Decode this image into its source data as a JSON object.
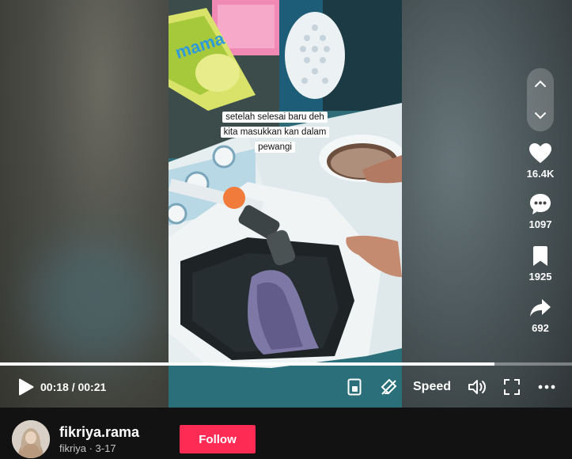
{
  "video": {
    "caption_lines": [
      "setelah selesai baru deh",
      "kita masukkan kan dalam",
      "pewangi"
    ],
    "product_brand": "mama"
  },
  "actions": [
    {
      "name": "like",
      "icon": "heart-icon",
      "count": "16.4K"
    },
    {
      "name": "comment",
      "icon": "comment-icon",
      "count": "1097"
    },
    {
      "name": "save",
      "icon": "bookmark-icon",
      "count": "1925"
    },
    {
      "name": "share",
      "icon": "share-icon",
      "count": "692"
    }
  ],
  "player": {
    "time": "00:18 / 00:21",
    "progress": 0.865,
    "speed_label": "Speed"
  },
  "author": {
    "username": "fikriya.rama",
    "nickname": "fikriya",
    "separator": "·",
    "date": "3-17",
    "follow_label": "Follow"
  },
  "colors": {
    "follow": "#fe2c55"
  }
}
